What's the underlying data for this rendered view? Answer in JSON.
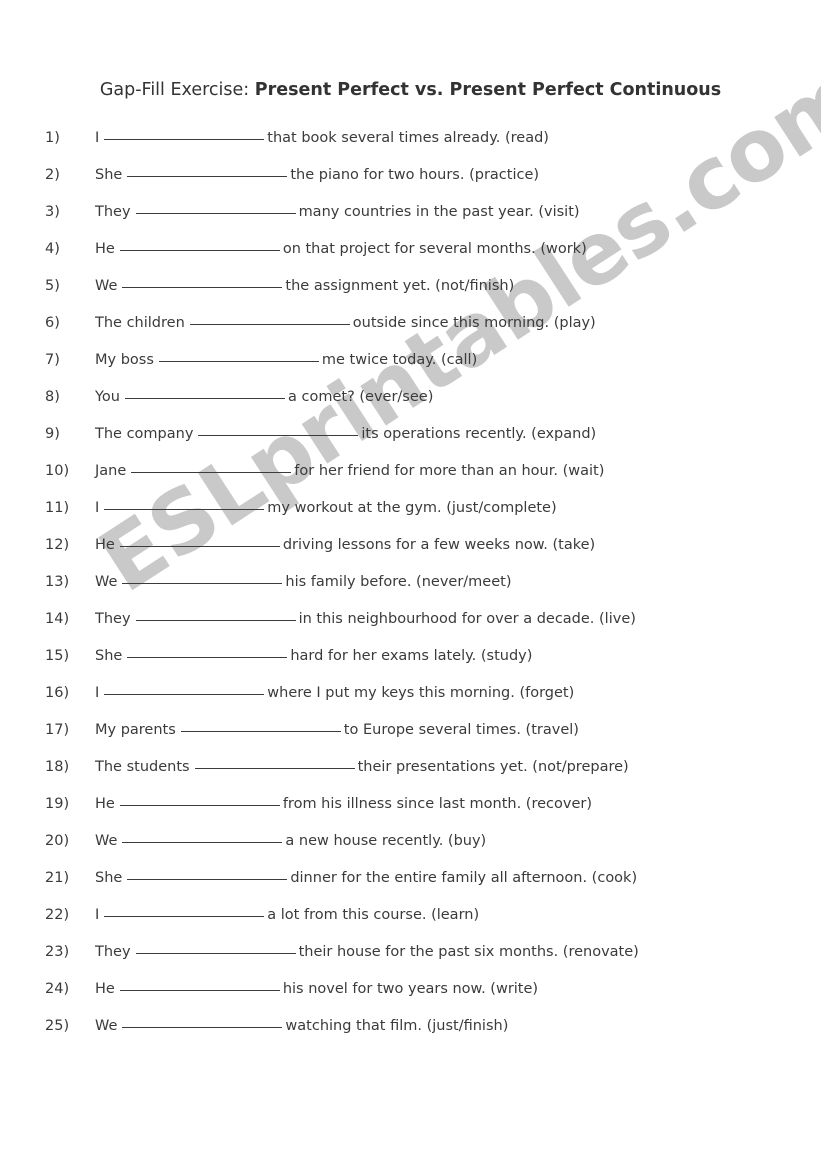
{
  "document": {
    "title_regular": "Gap-Fill Exercise:",
    "title_bold": "Present Perfect vs. Present Perfect Continuous",
    "watermark": "ESLprintables.com",
    "watermark_color": "#c9c9c9",
    "text_color": "#3b3b3b",
    "page_background": "#ffffff"
  },
  "questions": [
    {
      "num": "1)",
      "subject": "I",
      "tail": "that book several times already. (read)"
    },
    {
      "num": "2)",
      "subject": "She",
      "tail": "the piano for two hours. (practice)"
    },
    {
      "num": "3)",
      "subject": "They",
      "tail": "many countries in the past year. (visit)"
    },
    {
      "num": "4)",
      "subject": "He",
      "tail": "on that project for several months. (work)"
    },
    {
      "num": "5)",
      "subject": "We",
      "tail": "the assignment yet. (not/finish)"
    },
    {
      "num": "6)",
      "subject": "The children",
      "tail": "outside since this morning. (play)"
    },
    {
      "num": "7)",
      "subject": "My boss",
      "tail": "me twice today. (call)"
    },
    {
      "num": "8)",
      "subject": "You",
      "tail": "a comet? (ever/see)"
    },
    {
      "num": "9)",
      "subject": "The company",
      "tail": "its operations recently. (expand)"
    },
    {
      "num": "10)",
      "subject": "Jane",
      "tail": "for her friend for more than an hour. (wait)"
    },
    {
      "num": "11)",
      "subject": "I",
      "tail": "my workout at the gym. (just/complete)"
    },
    {
      "num": "12)",
      "subject": "He",
      "tail": "driving lessons for a few weeks now. (take)"
    },
    {
      "num": "13)",
      "subject": "We",
      "tail": "his family before. (never/meet)"
    },
    {
      "num": "14)",
      "subject": "They",
      "tail": "in this neighbourhood for over a decade. (live)"
    },
    {
      "num": "15)",
      "subject": "She",
      "tail": "hard for her exams lately. (study)"
    },
    {
      "num": "16)",
      "subject": "I",
      "tail": "where I put my keys this morning. (forget)"
    },
    {
      "num": "17)",
      "subject": "My parents",
      "tail": "to Europe several times. (travel)"
    },
    {
      "num": "18)",
      "subject": "The students",
      "tail": "their presentations yet. (not/prepare)"
    },
    {
      "num": "19)",
      "subject": "He",
      "tail": "from his illness since last month. (recover)"
    },
    {
      "num": "20)",
      "subject": "We",
      "tail": "a new house recently. (buy)"
    },
    {
      "num": "21)",
      "subject": "She",
      "tail": "dinner for the entire family all afternoon. (cook)"
    },
    {
      "num": "22)",
      "subject": "I",
      "tail": "a lot from this course. (learn)"
    },
    {
      "num": "23)",
      "subject": "They",
      "tail": "their house for the past six months. (renovate)"
    },
    {
      "num": "24)",
      "subject": "He",
      "tail": "his novel for two years now. (write)"
    },
    {
      "num": "25)",
      "subject": "We",
      "tail": "watching that film. (just/finish)"
    }
  ]
}
